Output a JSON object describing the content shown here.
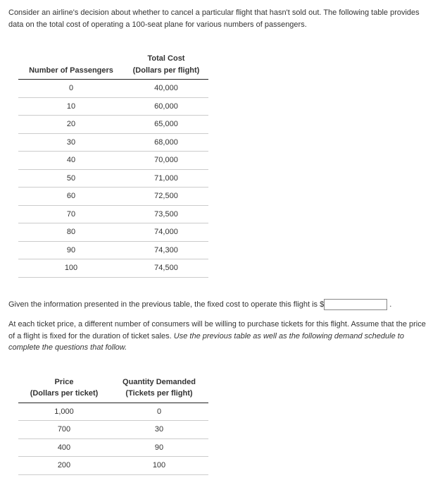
{
  "intro_text": "Consider an airline's decision about whether to cancel a particular flight that hasn't sold out. The following table provides data on the total cost of operating a 100-seat plane for various numbers of passengers.",
  "table1": {
    "header_passengers": "Number of Passengers",
    "header_cost_line1": "Total Cost",
    "header_cost_line2": "(Dollars per flight)",
    "rows": [
      {
        "p": "0",
        "c": "40,000"
      },
      {
        "p": "10",
        "c": "60,000"
      },
      {
        "p": "20",
        "c": "65,000"
      },
      {
        "p": "30",
        "c": "68,000"
      },
      {
        "p": "40",
        "c": "70,000"
      },
      {
        "p": "50",
        "c": "71,000"
      },
      {
        "p": "60",
        "c": "72,500"
      },
      {
        "p": "70",
        "c": "73,500"
      },
      {
        "p": "80",
        "c": "74,000"
      },
      {
        "p": "90",
        "c": "74,300"
      },
      {
        "p": "100",
        "c": "74,500"
      }
    ]
  },
  "fixed_cost_prefix": "Given the information presented in the previous table, the fixed cost to operate this flight is ",
  "fixed_cost_currency": "$",
  "fixed_cost_input_value": "",
  "fixed_cost_suffix": " .",
  "demand_intro": "At each ticket price, a different number of consumers will be willing to purchase tickets for this flight. Assume that the price of a flight is fixed for the duration of ticket sales. ",
  "demand_italic": "Use the previous table as well as the following demand schedule to complete the questions that follow.",
  "table2": {
    "header_price_line1": "Price",
    "header_price_line2": "(Dollars per ticket)",
    "header_qty_line1": "Quantity Demanded",
    "header_qty_line2": "(Tickets per flight)",
    "rows": [
      {
        "price": "1,000",
        "qty": "0"
      },
      {
        "price": "700",
        "qty": "30"
      },
      {
        "price": "400",
        "qty": "90"
      },
      {
        "price": "200",
        "qty": "100"
      }
    ]
  }
}
